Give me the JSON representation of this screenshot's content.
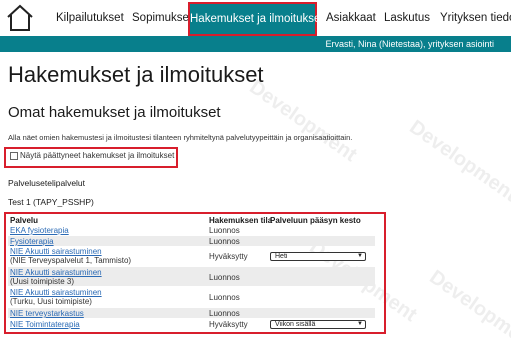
{
  "nav": {
    "items": [
      "Kilpailutukset",
      "Sopimukset",
      "Hakemukset ja ilmoitukset",
      "Asiakkaat",
      "Laskutus",
      "Yrityksen tiedot"
    ]
  },
  "userbar": {
    "text": "Ervasti, Nina (Nietestaa), yrityksen asiointi"
  },
  "page": {
    "title": "Hakemukset ja ilmoitukset",
    "subtitle": "Omat hakemukset ja ilmoitukset",
    "description": "Alla näet omien hakemustesi ja ilmoitustesi tilanteen ryhmiteltynä palvelutyypeittäin ja organisaatioittain.",
    "checkbox_label": "Näytä päättyneet hakemukset ja ilmoitukset",
    "section": "Palveluseteli­palvelut",
    "org": "Test 1 (TAPY_PSSHP)"
  },
  "table": {
    "headers": {
      "service": "Palvelu",
      "status": "Hakemuksen tila",
      "wait": "Palveluun pääsyn kesto"
    },
    "rows": [
      {
        "service": "EKA fysioterapia",
        "sub": "",
        "status": "Luonnos",
        "select": ""
      },
      {
        "service": "Fysioterapia",
        "sub": "",
        "status": "Luonnos",
        "select": ""
      },
      {
        "service": "NIE Akuutti sairastuminen",
        "sub": "(NIE Terveyspalvelut 1, Tammisto)",
        "status": "Hyväksytty",
        "select": "Heti"
      },
      {
        "service": "NIE Akuutti sairastuminen",
        "sub": "(Uusi toimipiste 3)",
        "status": "Luonnos",
        "select": ""
      },
      {
        "service": "NIE Akuutti sairastuminen",
        "sub": "(Turku, Uusi toimipiste)",
        "status": "Luonnos",
        "select": ""
      },
      {
        "service": "NIE terveystarkastus",
        "sub": "",
        "status": "Luonnos",
        "select": ""
      },
      {
        "service": "NIE Toimintaterapia",
        "sub": "",
        "status": "Hyväksytty",
        "select": "Viikon sisällä"
      }
    ]
  },
  "watermark": "Development",
  "colors": {
    "teal": "#087f8c",
    "highlight": "#d81e2c",
    "link": "#2a6ab5"
  }
}
